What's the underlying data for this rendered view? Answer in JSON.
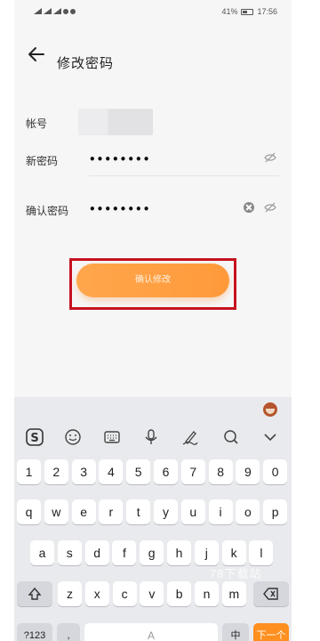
{
  "status_bar": {
    "battery": "41%",
    "time": "17:56"
  },
  "header": {
    "title": "修改密码",
    "back_icon": "arrow-left-icon"
  },
  "form": {
    "account_label": "帐号",
    "new_password_label": "新密码",
    "new_password_value": "••••••••",
    "confirm_password_label": "确认密码",
    "confirm_password_value": "••••••••"
  },
  "confirm_button": {
    "label": "确认修改",
    "gradient": [
      "#ffa64c",
      "#ff9a3a"
    ]
  },
  "highlight_color": "#c6121f",
  "keyboard": {
    "toolbar_icons": [
      "sogou-s-icon",
      "emoji-icon",
      "keyboard-icon",
      "microphone-icon",
      "handwriting-icon",
      "search-icon",
      "chevron-down-icon"
    ],
    "number_row": [
      "1",
      "2",
      "3",
      "4",
      "5",
      "6",
      "7",
      "8",
      "9",
      "0"
    ],
    "row_q": [
      "q",
      "w",
      "e",
      "r",
      "t",
      "y",
      "u",
      "i",
      "o",
      "p"
    ],
    "row_a": [
      "a",
      "s",
      "d",
      "f",
      "g",
      "h",
      "j",
      "k",
      "l"
    ],
    "row_z": [
      "z",
      "x",
      "c",
      "v",
      "b",
      "n",
      "m"
    ],
    "bottom_row": {
      "symbols": "?123",
      "punct": ",",
      "space": "A",
      "lang": "中",
      "enter": "下一个"
    },
    "watermark": "78下载站"
  }
}
